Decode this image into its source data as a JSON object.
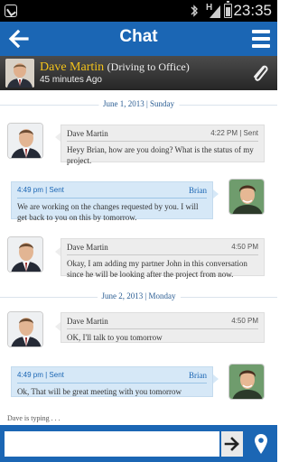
{
  "status_bar": {
    "network": "H",
    "time": "23:35"
  },
  "app_bar": {
    "title": "Chat",
    "back_icon": "arrow-left-icon",
    "menu_icon": "hamburger-menu-icon"
  },
  "contact": {
    "name": "Dave Martin",
    "status": "(Driving to Office)",
    "last_seen": "45 minutes Ago"
  },
  "dates": [
    "June 1, 2013 | Sunday",
    "June 2, 2013 | Monday"
  ],
  "messages": [
    {
      "direction": "in",
      "sender": "Dave Martin",
      "meta": "4:22 PM | Sent",
      "text": "Heyy Brian, how are you doing? What is the status of my project."
    },
    {
      "direction": "out",
      "sender": "Brian",
      "meta": "4:49 pm | Sent",
      "text": "We are working on the changes requested by you. I will get back to you on this by tomorrow."
    },
    {
      "direction": "in",
      "sender": "Dave Martin",
      "meta": "4:50 PM",
      "text": "Okay, I am adding my partner John in this conversation since he will be looking after the project from now."
    },
    {
      "direction": "in",
      "sender": "Dave Martin",
      "meta": "4:50 PM",
      "text": "OK, I'll talk to you tomorrow"
    },
    {
      "direction": "out",
      "sender": "Brian",
      "meta": "4:49 pm | Sent",
      "text": "Ok, That will be great meeting with you tomorrow"
    }
  ],
  "typing_indicator": "Dave is typing . . .",
  "composer": {
    "placeholder": "",
    "send_icon": "send-arrow-icon",
    "location_icon": "location-pin-icon"
  },
  "colors": {
    "primary": "#1b66b4",
    "contact_name": "#f2c21b",
    "incoming_bubble": "#ededed",
    "outgoing_bubble": "#d6e8f7"
  }
}
